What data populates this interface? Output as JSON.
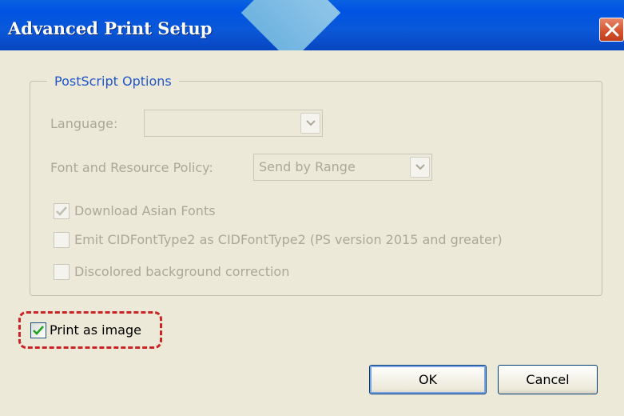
{
  "window": {
    "title": "Advanced Print Setup"
  },
  "postscript": {
    "group_label": "PostScript Options",
    "language": {
      "label": "Language:",
      "value": ""
    },
    "font_policy": {
      "label": "Font and Resource Policy:",
      "value": "Send by Range"
    },
    "download_asian_fonts": {
      "label": "Download Asian Fonts",
      "checked": true,
      "enabled": false
    },
    "emit_cidfonttype2": {
      "label": "Emit CIDFontType2 as CIDFontType2 (PS version 2015 and greater)",
      "checked": false,
      "enabled": false
    },
    "discolored_bg": {
      "label": "Discolored background correction",
      "checked": false,
      "enabled": false
    }
  },
  "print_as_image": {
    "label": "Print as image",
    "checked": true
  },
  "buttons": {
    "ok": "OK",
    "cancel": "Cancel"
  },
  "colors": {
    "titlebar": "#0054e3",
    "highlight": "#c92525",
    "group_label": "#1f55c9",
    "check_green": "#21a121"
  }
}
